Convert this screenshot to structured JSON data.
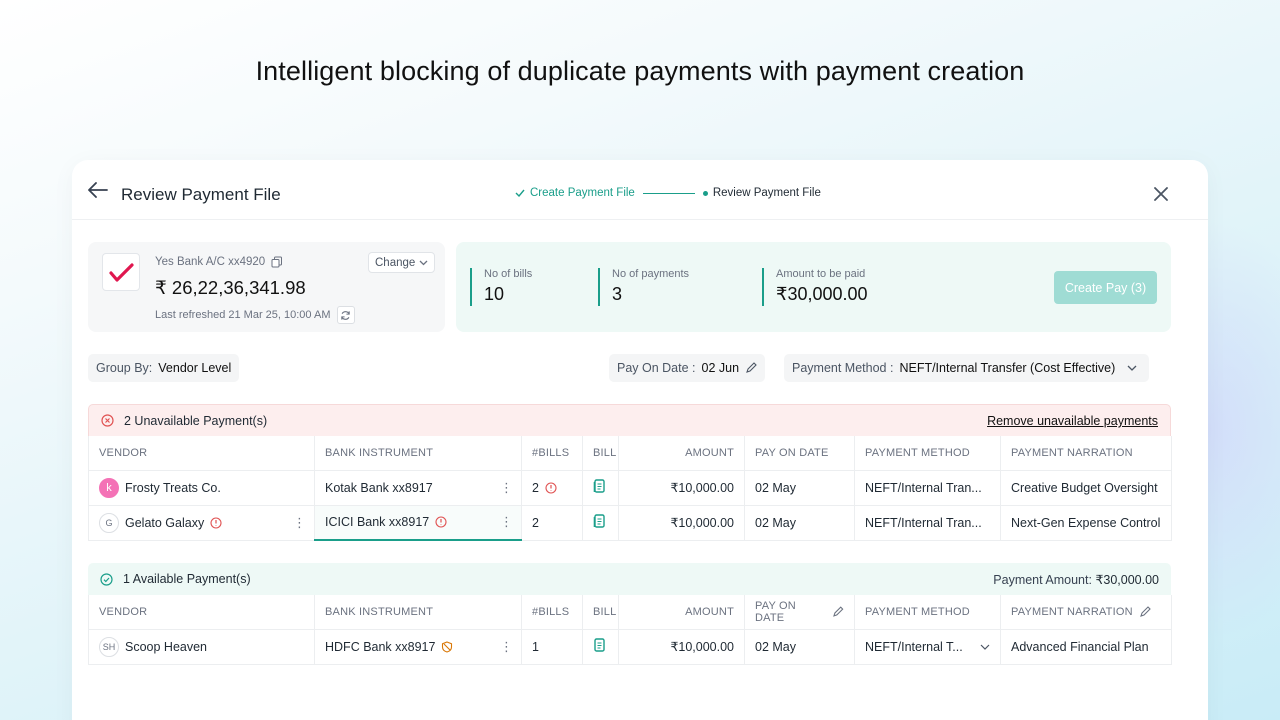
{
  "headline": "Intelligent blocking of duplicate payments with payment creation",
  "header": {
    "title": "Review Payment File",
    "steps": [
      {
        "label": "Create Payment File",
        "state": "done"
      },
      {
        "label": "Review Payment File",
        "state": "current"
      }
    ]
  },
  "bank": {
    "account": "Yes Bank A/C xx4920",
    "change_label": "Change",
    "balance": "₹ 26,22,36,341.98",
    "last_refreshed": "Last refreshed 21 Mar 25, 10:00 AM"
  },
  "summary": {
    "bills_label": "No of bills",
    "bills_value": "10",
    "payments_label": "No of payments",
    "payments_value": "3",
    "amount_label": "Amount to be paid",
    "amount_value": "₹30,000.00",
    "create_button": "Create Pay (3)"
  },
  "filters": {
    "group_by_label": "Group By:",
    "group_by_value": "Vendor Level",
    "pay_on_label": "Pay On Date :",
    "pay_on_value": "02 Jun",
    "method_label": "Payment Method :",
    "method_value": "NEFT/Internal Transfer (Cost Effective)"
  },
  "columns": [
    "VENDOR",
    "BANK INSTRUMENT",
    "#BILLS",
    "BILL",
    "AMOUNT",
    "PAY ON DATE",
    "PAYMENT METHOD",
    "PAYMENT NARRATION"
  ],
  "unavailable": {
    "title": "2 Unavailable Payment(s)",
    "action": "Remove unavailable payments",
    "rows": [
      {
        "avatar": "k",
        "vendor": "Frosty Treats Co.",
        "bank": "Kotak Bank xx8917",
        "bills": "2",
        "amount": "₹10,000.00",
        "date": "02 May",
        "method": "NEFT/Internal Tran...",
        "narration": "Creative Budget Oversight"
      },
      {
        "avatar": "G",
        "vendor": "Gelato Galaxy",
        "bank": "ICICI Bank xx8917",
        "bills": "2",
        "amount": "₹10,000.00",
        "date": "02 May",
        "method": "NEFT/Internal Tran...",
        "narration": "Next-Gen Expense Control"
      }
    ]
  },
  "available": {
    "title": "1 Available Payment(s)",
    "amount_label": "Payment Amount:",
    "amount_value": "₹30,000.00",
    "rows": [
      {
        "avatar": "SH",
        "vendor": "Scoop Heaven",
        "bank": "HDFC Bank xx8917",
        "bills": "1",
        "amount": "₹10,000.00",
        "date": "02 May",
        "method": "NEFT/Internal T...",
        "narration": "Advanced Financial Plan"
      }
    ]
  },
  "colors": {
    "accent": "#1a9e8a",
    "error": "#e05252",
    "accent_bg": "#eef9f6",
    "error_bg": "#fdeeee"
  }
}
